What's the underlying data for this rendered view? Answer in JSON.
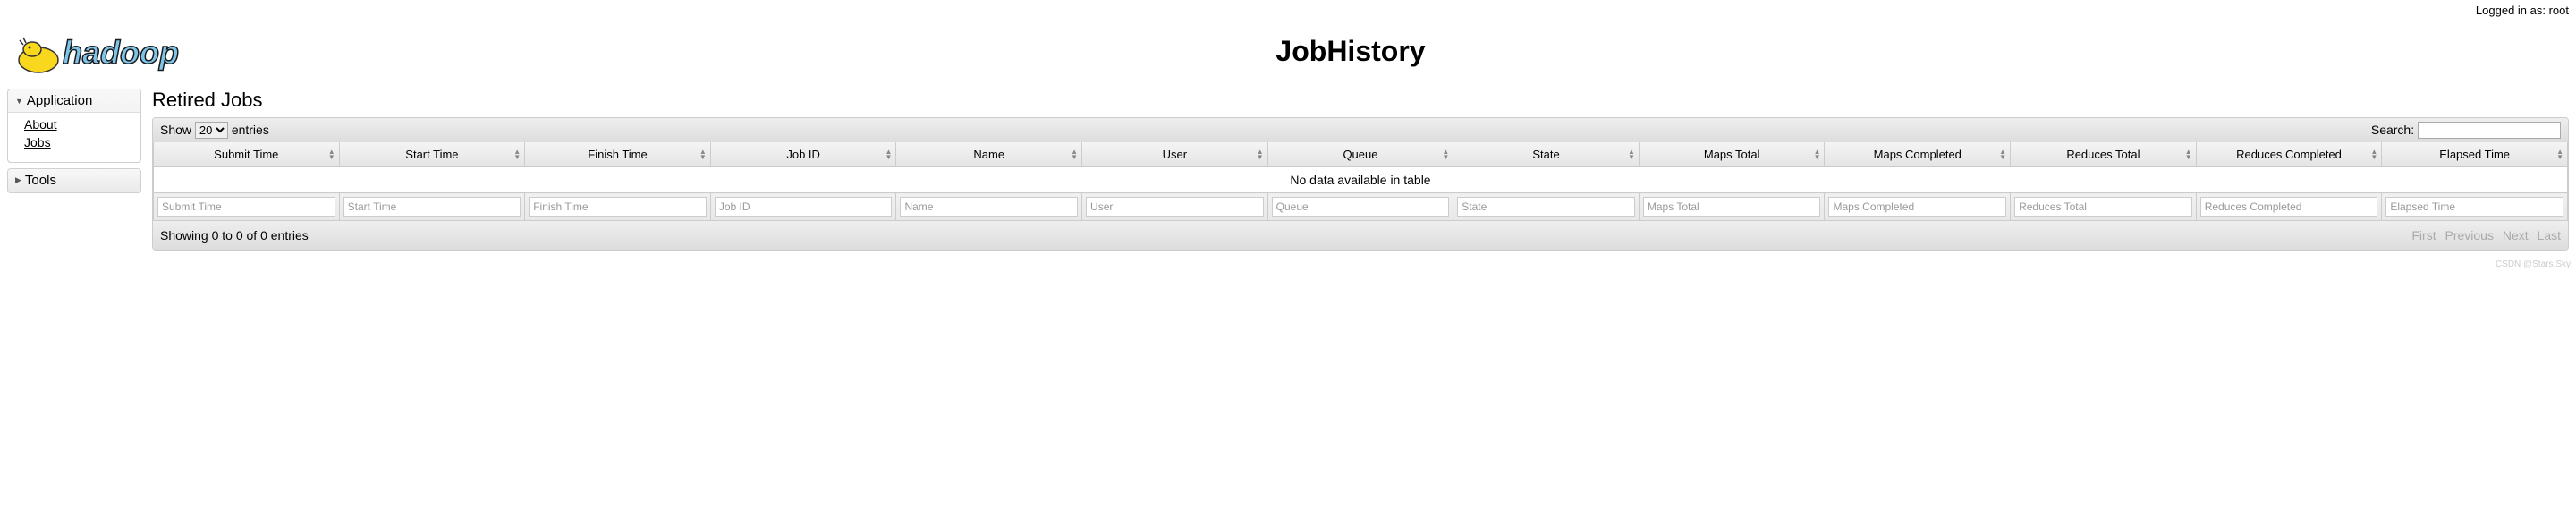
{
  "login": {
    "label": "Logged in as: root"
  },
  "logo": {
    "name": "hadoop"
  },
  "page": {
    "title": "JobHistory"
  },
  "sidebar": {
    "sections": [
      {
        "label": "Application",
        "expanded": true,
        "items": [
          {
            "label": "About"
          },
          {
            "label": "Jobs"
          }
        ]
      },
      {
        "label": "Tools",
        "expanded": false
      }
    ]
  },
  "content": {
    "heading": "Retired Jobs",
    "show_prefix": "Show",
    "show_value": "20",
    "show_suffix": "entries",
    "search_label": "Search:",
    "columns": [
      {
        "label": "Submit Time",
        "placeholder": "Submit Time"
      },
      {
        "label": "Start Time",
        "placeholder": "Start Time"
      },
      {
        "label": "Finish Time",
        "placeholder": "Finish Time"
      },
      {
        "label": "Job ID",
        "placeholder": "Job ID"
      },
      {
        "label": "Name",
        "placeholder": "Name"
      },
      {
        "label": "User",
        "placeholder": "User"
      },
      {
        "label": "Queue",
        "placeholder": "Queue"
      },
      {
        "label": "State",
        "placeholder": "State"
      },
      {
        "label": "Maps Total",
        "placeholder": "Maps Total"
      },
      {
        "label": "Maps Completed",
        "placeholder": "Maps Completed"
      },
      {
        "label": "Reduces Total",
        "placeholder": "Reduces Total"
      },
      {
        "label": "Reduces Completed",
        "placeholder": "Reduces Completed"
      },
      {
        "label": "Elapsed Time",
        "placeholder": "Elapsed Time"
      }
    ],
    "empty_message": "No data available in table",
    "info": "Showing 0 to 0 of 0 entries",
    "pager": {
      "first": "First",
      "prev": "Previous",
      "next": "Next",
      "last": "Last"
    }
  },
  "watermark": "CSDN @Stars.Sky"
}
